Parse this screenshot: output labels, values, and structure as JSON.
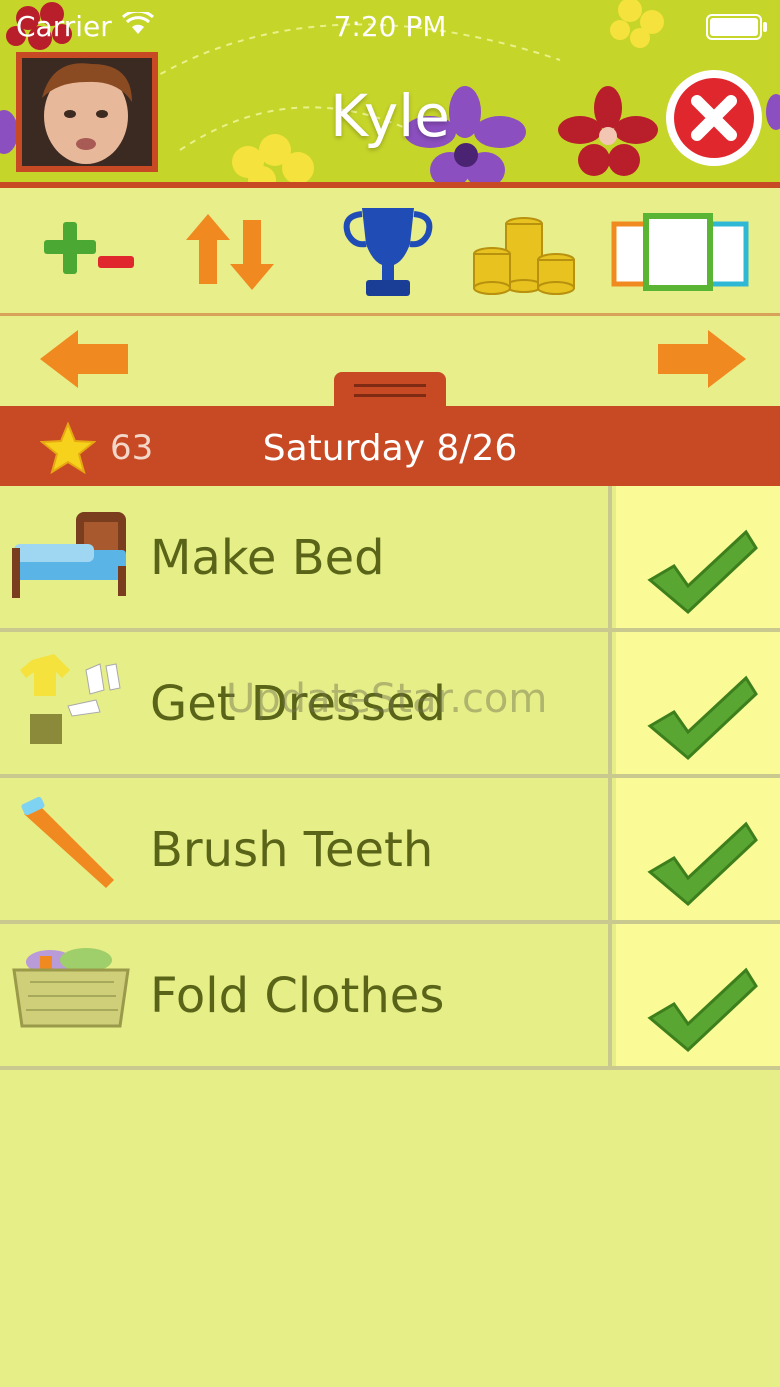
{
  "status_bar": {
    "carrier": "Carrier",
    "time": "7:20 PM"
  },
  "header": {
    "child_name": "Kyle"
  },
  "toolbar": {
    "items": [
      {
        "icon": "plus-minus-icon"
      },
      {
        "icon": "sort-arrows-icon"
      },
      {
        "icon": "trophy-icon"
      },
      {
        "icon": "coins-icon"
      },
      {
        "icon": "cards-icon"
      }
    ]
  },
  "date_bar": {
    "points": "63",
    "date": "Saturday 8/26"
  },
  "chores": [
    {
      "label": "Make Bed",
      "icon": "bed-icon",
      "done": true
    },
    {
      "label": "Get Dressed",
      "icon": "clothes-icon",
      "done": true
    },
    {
      "label": "Brush Teeth",
      "icon": "toothbrush-icon",
      "done": true
    },
    {
      "label": "Fold Clothes",
      "icon": "laundry-basket-icon",
      "done": true
    }
  ],
  "watermark": "UpdateStar.com",
  "colors": {
    "header_green": "#c6d52a",
    "accent_red": "#c84a25",
    "row_bg": "#e6ee87",
    "check_bg": "#fafb96",
    "check_green": "#5aa632"
  }
}
